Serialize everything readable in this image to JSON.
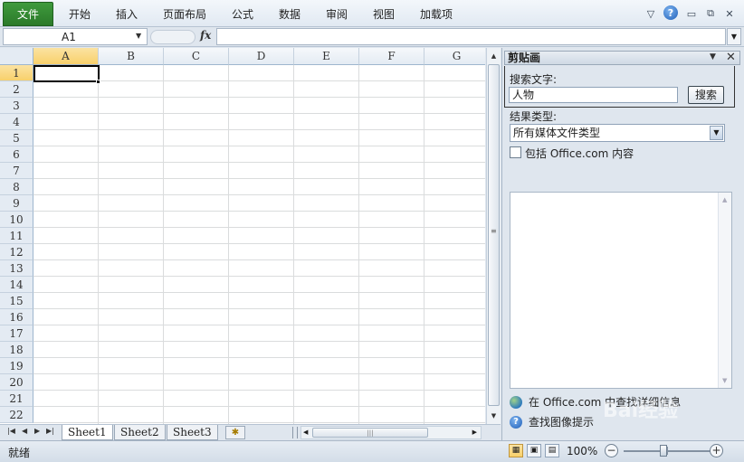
{
  "ribbon": {
    "file_tab": "文件",
    "tabs": [
      "开始",
      "插入",
      "页面布局",
      "公式",
      "数据",
      "审阅",
      "视图",
      "加载项"
    ]
  },
  "formula_bar": {
    "name_box": "A1",
    "fx_label": "fx",
    "formula_value": ""
  },
  "sheet": {
    "columns": [
      "A",
      "B",
      "C",
      "D",
      "E",
      "F",
      "G"
    ],
    "rows": [
      "1",
      "2",
      "3",
      "4",
      "5",
      "6",
      "7",
      "8",
      "9",
      "10",
      "11",
      "12",
      "13",
      "14",
      "15",
      "16",
      "17",
      "18",
      "19",
      "20",
      "21",
      "22"
    ],
    "active_cell": "A1"
  },
  "sheet_tabs": [
    "Sheet1",
    "Sheet2",
    "Sheet3"
  ],
  "clip_art_pane": {
    "title": "剪贴画",
    "search_label": "搜索文字:",
    "search_value": "人物",
    "search_button": "搜索",
    "result_type_label": "结果类型:",
    "result_type_value": "所有媒体文件类型",
    "include_office_label": "包括 Office.com 内容",
    "include_office_checked": false,
    "link_more_info": "在 Office.com 中查找详细信息",
    "link_search_tips": "查找图像提示"
  },
  "status_bar": {
    "status": "就绪",
    "zoom": "100%"
  },
  "watermark": "Bai经验",
  "colors": {
    "file_tab": "#2b7a2a",
    "active_header": "#f8d06b",
    "gridline": "#dadcdd"
  }
}
